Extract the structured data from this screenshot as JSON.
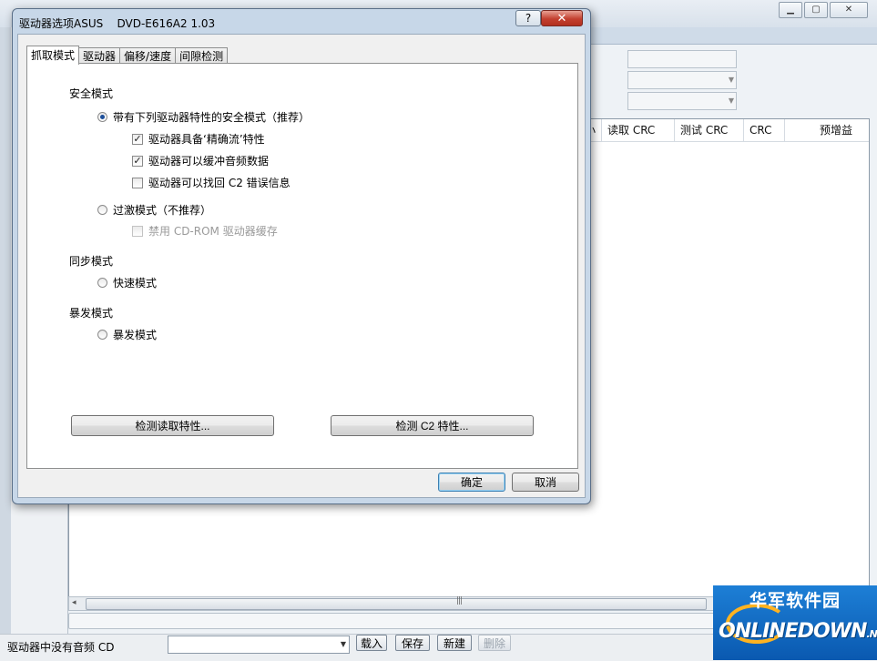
{
  "main": {
    "grid_columns": [
      "小",
      "读取 CRC",
      "测试 CRC",
      "CRC",
      "预增益"
    ],
    "status_text": "驱动器中没有音频 CD",
    "buttons": {
      "load": "载入",
      "save": "保存",
      "new": "新建",
      "delete": "删除"
    }
  },
  "dialog": {
    "title": "驱动器选项ASUS    DVD-E616A2 1.03",
    "help_glyph": "?",
    "close_glyph": "✕",
    "tabs": [
      {
        "label": "抓取模式",
        "active": true
      },
      {
        "label": "驱动器",
        "active": false
      },
      {
        "label": "偏移/速度",
        "active": false
      },
      {
        "label": "间隙检测",
        "active": false
      }
    ],
    "security": {
      "label": "安全模式",
      "secure_option": "带有下列驱动器特性的安全模式（推荐）",
      "accurate_stream": "驱动器具备‘精确流’特性",
      "audio_cache": "驱动器可以缓冲音频数据",
      "c2_errors": "驱动器可以找回 C2 错误信息",
      "paranoid_option": "过激模式（不推荐）",
      "disable_cache": "禁用 CD-ROM 驱动器缓存"
    },
    "sync": {
      "label": "同步模式",
      "fast_option": "快速模式"
    },
    "burst": {
      "label": "暴发模式",
      "burst_option": "暴发模式"
    },
    "detect_read_btn": "检测读取特性...",
    "detect_c2_btn": "检测 C2 特性...",
    "ok_btn": "确定",
    "cancel_btn": "取消",
    "check_glyph": "✓"
  },
  "watermark": {
    "cn": "华军软件园",
    "en": "ONLINEDOWN",
    "en_suffix": ".NET"
  }
}
